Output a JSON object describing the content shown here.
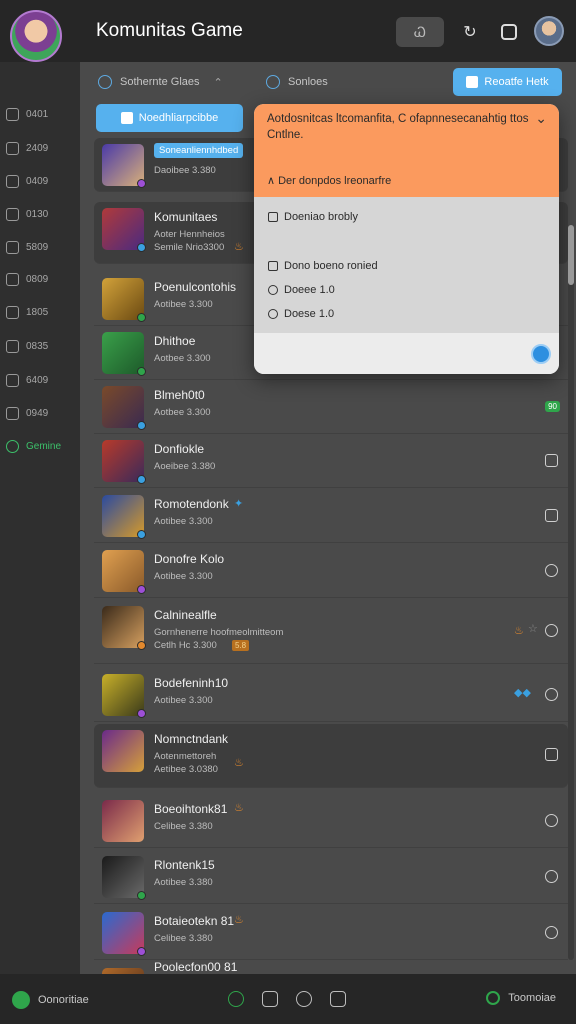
{
  "header": {
    "title": "Komunitas Game",
    "dark_button": "Ꮗ"
  },
  "sidebar": {
    "items": [
      {
        "label": "0401"
      },
      {
        "label": "2409"
      },
      {
        "label": "0409"
      },
      {
        "label": "0130"
      },
      {
        "label": "5809"
      },
      {
        "label": "0809"
      },
      {
        "label": "1805"
      },
      {
        "label": "0835"
      },
      {
        "label": "6409"
      },
      {
        "label": "0949"
      },
      {
        "label": "Gemine"
      }
    ]
  },
  "filters": {
    "left": "Sothernte Glaes",
    "right": "Sonloes",
    "top_button": "Reoatfe Hetk",
    "new_button": "Noedhliarpcibbe"
  },
  "list": [
    {
      "tag": "Soneanliennhdbed",
      "sub": "Daoibee 3.380"
    },
    {
      "name": "Komunitaes",
      "sub": "Aoter Hennheios",
      "sub2": "Semile Nrio3300"
    },
    {
      "name": "Poenulcontohis",
      "sub": "Aotibee 3.300"
    },
    {
      "name": "Dhithoe",
      "sub": "Aotbee 3.300"
    },
    {
      "name": "Blmeh0t0",
      "sub": "Aotbee 3.300",
      "badge": "90"
    },
    {
      "name": "Donfiokle",
      "sub": "Aoeibee 3.380"
    },
    {
      "name": "Romotendonk",
      "sub": "Aotibee 3.300"
    },
    {
      "name": "Donofre Kolo",
      "sub": "Aotibee 3.300"
    },
    {
      "name": "Calninealfle",
      "sub": "Gornhenerre hoofmeolmitteom",
      "sub2": "Cetlh Hc 3.300",
      "rating": "5.8"
    },
    {
      "name": "Bodefeninh10",
      "sub": "Aotibee 3.300"
    },
    {
      "name": "Nomnctndank",
      "sub": "Aotenmettoreh",
      "sub2": "Aetibee 3.0380"
    },
    {
      "name": "Boeoihtonk81",
      "sub": "Celibee 3.380"
    },
    {
      "name": "Rlontenk15",
      "sub": "Aotibee 3.380"
    },
    {
      "name": "Botaieotekn 81",
      "sub": "Celibee 3.380"
    },
    {
      "name": "Poolecfon00 81"
    }
  ],
  "dropdown": {
    "message": "Aotdosnitcas ltcomanfita, C ofapnnesecanahtig ttos Cntlne.",
    "option": "Der donpdos lreonarfre",
    "item1": "Doeniao brobly",
    "item2": "Dono boeno ronied",
    "item3": "Doeee 1.0",
    "item4": "Doese 1.0"
  },
  "bottombar": {
    "left": "Oonoritiae",
    "right": "Toomoiae"
  },
  "colors": {
    "accent_blue": "#56b1ee",
    "accent_orange": "#fb9a5e",
    "active_green": "#3cc06a"
  }
}
